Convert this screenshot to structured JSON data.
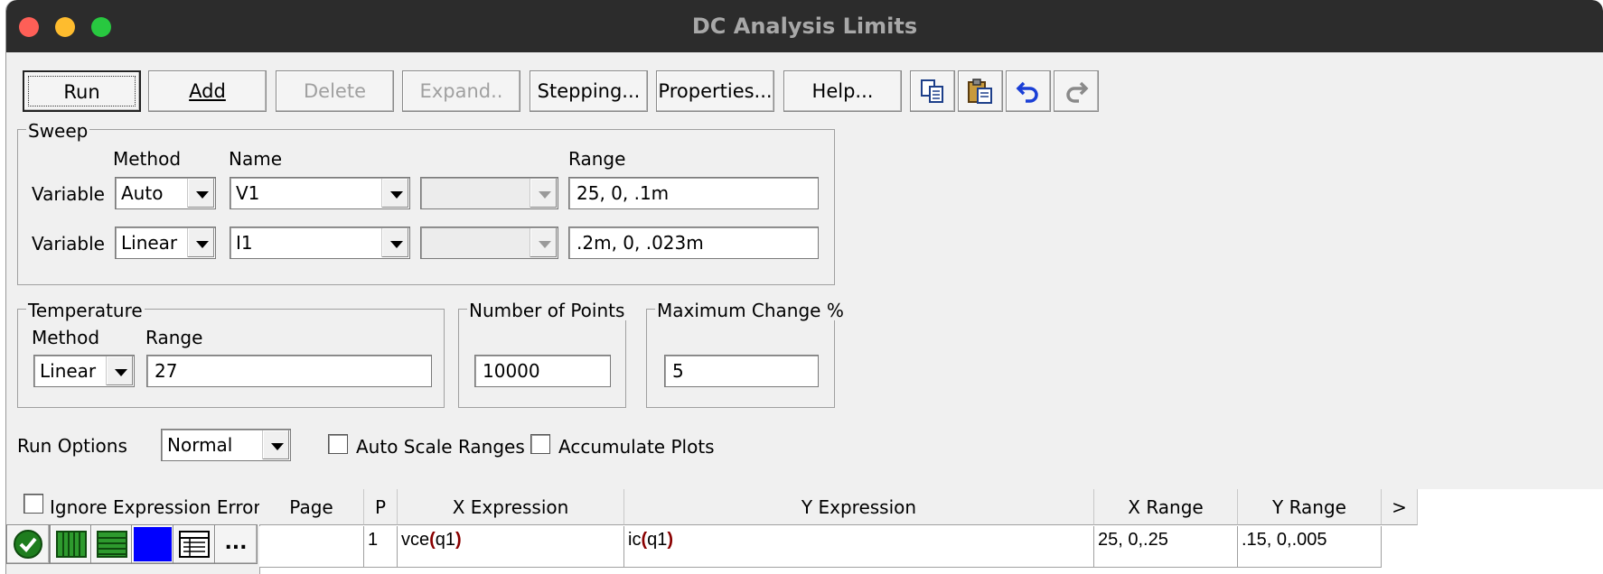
{
  "window": {
    "title": "DC Analysis Limits"
  },
  "toolbar": {
    "run": "Run",
    "add": "Add",
    "delete": "Delete",
    "expand": "Expand..",
    "stepping": "Stepping...",
    "properties": "Properties...",
    "help": "Help..."
  },
  "sweep": {
    "legend": "Sweep",
    "method_header": "Method",
    "name_header": "Name",
    "range_header": "Range",
    "rows": [
      {
        "label": "Variable",
        "method": "Auto",
        "name": "V1",
        "range": "25, 0, .1m"
      },
      {
        "label": "Variable",
        "method": "Linear",
        "name": "I1",
        "range": ".2m, 0, .023m"
      }
    ]
  },
  "temperature": {
    "legend": "Temperature",
    "method_header": "Method",
    "range_header": "Range",
    "method": "Linear",
    "range": "27"
  },
  "points": {
    "legend": "Number of Points",
    "value": "10000"
  },
  "maxchange": {
    "legend": "Maximum Change %",
    "value": "5"
  },
  "run_options": {
    "label": "Run Options",
    "value": "Normal",
    "auto_scale": "Auto Scale Ranges",
    "accumulate": "Accumulate Plots"
  },
  "ignore_errors": "Ignore Expression Errors",
  "grid": {
    "headers": {
      "page": "Page",
      "p": "P",
      "x_expr": "X Expression",
      "y_expr": "Y Expression",
      "x_range": "X Range",
      "y_range": "Y Range",
      "more": ">"
    },
    "row": {
      "page": "",
      "p": "1",
      "x_fn": "vce",
      "x_arg": "q1",
      "y_fn": "ic",
      "y_arg": "q1",
      "x_range": "25, 0,.25",
      "y_range": ".15, 0,.005"
    }
  },
  "colors": {
    "plot_color": "#0000ff",
    "check_green": "#1e7d1e"
  },
  "side_buttons": {
    "more": "..."
  }
}
